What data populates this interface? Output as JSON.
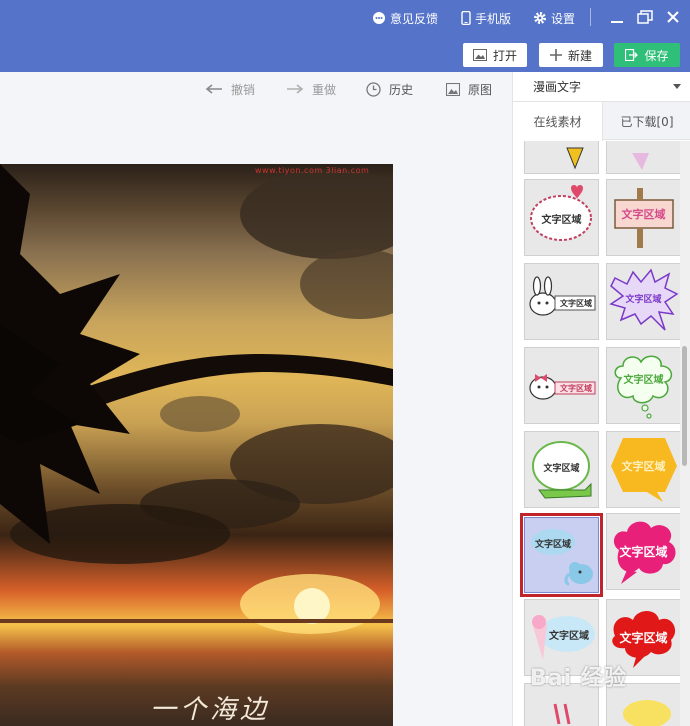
{
  "header": {
    "feedback_label": "意见反馈",
    "mobile_label": "手机版",
    "settings_label": "设置",
    "open_label": "打开",
    "new_label": "新建",
    "save_label": "保存"
  },
  "toolbar": {
    "undo_label": "撤销",
    "redo_label": "重做",
    "history_label": "历史",
    "original_label": "原图"
  },
  "photo": {
    "watermark_text": "www.tiyon.com 3lian.com",
    "caption_text": "一个海边"
  },
  "panel": {
    "category_value": "漫画文字",
    "tabs": [
      {
        "label": "在线素材"
      },
      {
        "label": "已下载[0]"
      }
    ],
    "tile_text": "文字区域"
  },
  "watermark": "Bai 经验",
  "colors": {
    "header_bg": "#5473c9",
    "save_btn": "#2fbf78",
    "selection_border": "#c0252b"
  }
}
